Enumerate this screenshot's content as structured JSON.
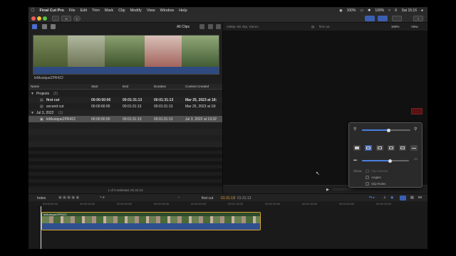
{
  "menubar": {
    "app_name": "Final Cut Pro",
    "items": [
      "File",
      "Edit",
      "Trim",
      "Mark",
      "Clip",
      "Modify",
      "View",
      "Window",
      "Help"
    ],
    "battery": "100%",
    "battery2": "100%",
    "clock": "Sat 15:16"
  },
  "browser": {
    "filter": "All Clips",
    "clip_label": "leMusique2PR422",
    "columns": [
      "Name",
      "Start",
      "End",
      "Duration",
      "Content Created"
    ],
    "rows": [
      {
        "indent": 0,
        "disclosure": true,
        "name": "Projects",
        "count": "(2)",
        "start": "",
        "end": "",
        "duration": "",
        "created": ""
      },
      {
        "indent": 1,
        "disclosure": false,
        "name": "first cut",
        "count": "",
        "start": "00:00:00:00",
        "end": "00:01:31:13",
        "duration": "00:01:31:13",
        "created": "Mar 25, 2023 at 18:",
        "bold": true
      },
      {
        "indent": 1,
        "disclosure": false,
        "name": "second cut",
        "count": "",
        "start": "00:00:00:00",
        "end": "00:01:31:13",
        "duration": "00:01:31:13",
        "created": "Mar 25, 2023 at 18:"
      },
      {
        "indent": 0,
        "disclosure": true,
        "name": "Jul 3, 2022",
        "count": "(1)",
        "start": "",
        "end": "",
        "duration": "",
        "created": ""
      },
      {
        "indent": 1,
        "disclosure": false,
        "name": "leMusique2PR422",
        "count": "",
        "start": "00:00:00:00",
        "end": "00:01:31:13",
        "duration": "00:01:31:13",
        "created": "Jul 3, 2022 at 19:32",
        "selected": true
      }
    ],
    "footer": "1 of 3 selected, 01:31:13"
  },
  "viewer": {
    "format": "1080p HD 25p, Stereo",
    "project_name": "first cut",
    "zoom": "100%",
    "view_menu": "View"
  },
  "popover": {
    "show_label": "Show:",
    "options": [
      {
        "label": "Clip Names",
        "checked": false,
        "enabled": false
      },
      {
        "label": "Angles",
        "checked": false,
        "enabled": true
      },
      {
        "label": "Clip Roles",
        "checked": false,
        "enabled": true
      }
    ],
    "clip_height_level": 0.6,
    "zoom_level": 0.55
  },
  "timeline": {
    "index_label": "Index",
    "project_name": "first cut",
    "timecode_current": "01:31:13",
    "timecode_total": "01:31:13",
    "ruler": [
      "00:00:00:00",
      "00:00:15:00",
      "00:00:30:00",
      "00:00:45:00",
      "00:01:00:00",
      "00:01:15:00",
      "00:01:30:00",
      "00:01:45:00",
      "00:02:00:00",
      "00:02:15:00"
    ],
    "clip_name": "leMusique2PR422"
  },
  "colors": {
    "accent": "#4a7fe0",
    "clip_border": "#d9a630",
    "timecode": "#e0a020"
  }
}
